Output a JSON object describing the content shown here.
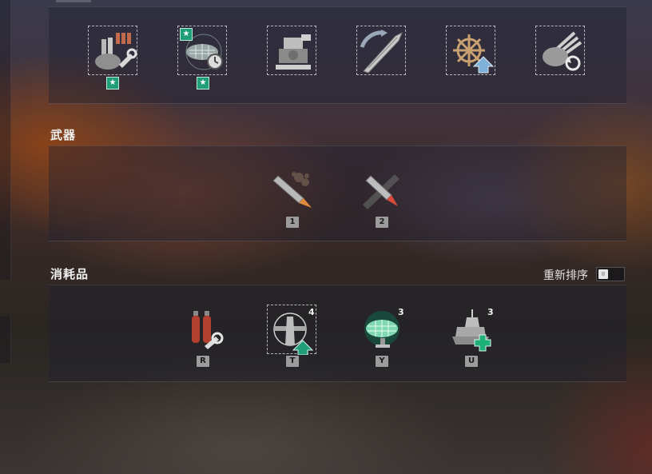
{
  "sections": {
    "weapons_title": "武器",
    "consumables_title": "消耗品"
  },
  "upgrades": [
    {
      "icon": "main-battery-mod-icon",
      "starred": true
    },
    {
      "icon": "radar-timer-mod-icon",
      "starred": true
    },
    {
      "icon": "aa-mount-mod-icon",
      "starred": false
    },
    {
      "icon": "hull-mod-icon",
      "starred": false
    },
    {
      "icon": "steering-upgrade-icon",
      "starred": false
    },
    {
      "icon": "gun-reload-mod-icon",
      "starred": false
    }
  ],
  "star_glyph": "★",
  "weapons": [
    {
      "icon": "he-shell-icon",
      "key": "1"
    },
    {
      "icon": "ap-shell-icon",
      "key": "2"
    }
  ],
  "consumables": [
    {
      "icon": "damage-control-party-icon",
      "key": "R",
      "count": ""
    },
    {
      "icon": "catapult-fighter-icon",
      "key": "T",
      "count": "4"
    },
    {
      "icon": "radar-icon",
      "key": "Y",
      "count": "3"
    },
    {
      "icon": "repair-party-icon",
      "key": "U",
      "count": "3"
    }
  ],
  "reorder": {
    "label": "重新排序",
    "knob": "II"
  },
  "colors": {
    "accent_green": "#1f9e78",
    "keycap_bg": "#9c9c9c"
  }
}
